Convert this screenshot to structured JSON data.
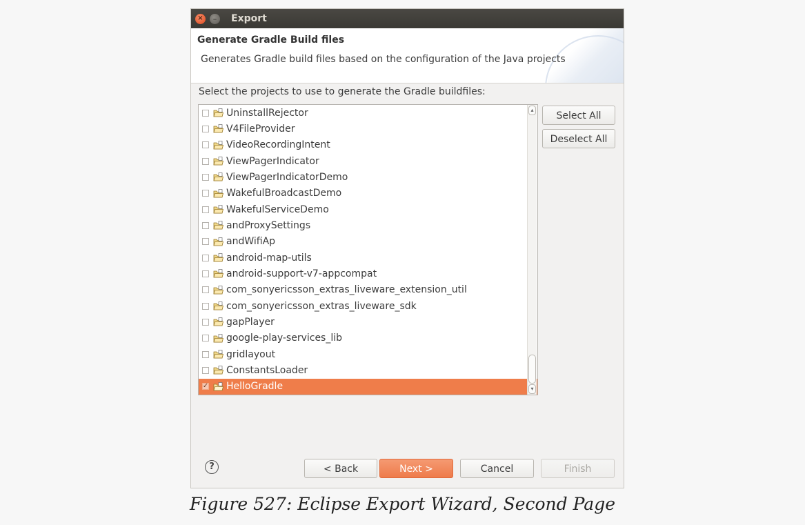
{
  "window": {
    "title": "Export",
    "close_glyph": "×",
    "minimize_glyph": "–"
  },
  "banner": {
    "title": "Generate Gradle Build files",
    "description": "Generates Gradle build files based on the configuration of the Java projects"
  },
  "prompt": "Select the projects to use to generate the Gradle buildfiles:",
  "projects": [
    {
      "name": "UninstallRejector",
      "checked": false
    },
    {
      "name": "V4FileProvider",
      "checked": false
    },
    {
      "name": "VideoRecordingIntent",
      "checked": false
    },
    {
      "name": "ViewPagerIndicator",
      "checked": false
    },
    {
      "name": "ViewPagerIndicatorDemo",
      "checked": false
    },
    {
      "name": "WakefulBroadcastDemo",
      "checked": false
    },
    {
      "name": "WakefulServiceDemo",
      "checked": false
    },
    {
      "name": "andProxySettings",
      "checked": false
    },
    {
      "name": "andWifiAp",
      "checked": false
    },
    {
      "name": "android-map-utils",
      "checked": false
    },
    {
      "name": "android-support-v7-appcompat",
      "checked": false
    },
    {
      "name": "com_sonyericsson_extras_liveware_extension_util",
      "checked": false
    },
    {
      "name": "com_sonyericsson_extras_liveware_sdk",
      "checked": false
    },
    {
      "name": "gapPlayer",
      "checked": false
    },
    {
      "name": "google-play-services_lib",
      "checked": false
    },
    {
      "name": "gridlayout",
      "checked": false
    },
    {
      "name": "ConstantsLoader",
      "checked": false
    },
    {
      "name": "HelloGradle",
      "checked": true,
      "selected": true
    }
  ],
  "side_buttons": {
    "select_all": "Select All",
    "deselect_all": "Deselect All"
  },
  "footer": {
    "help_glyph": "?",
    "back": "< Back",
    "next": "Next >",
    "cancel": "Cancel",
    "finish": "Finish"
  },
  "scrollbar": {
    "up_glyph": "▴",
    "down_glyph": "▾"
  },
  "check_glyph": "✓",
  "caption": "Figure 527: Eclipse Export Wizard, Second Page",
  "colors": {
    "accent": "#ef7d4a",
    "titlebar": "#3c3b37"
  }
}
